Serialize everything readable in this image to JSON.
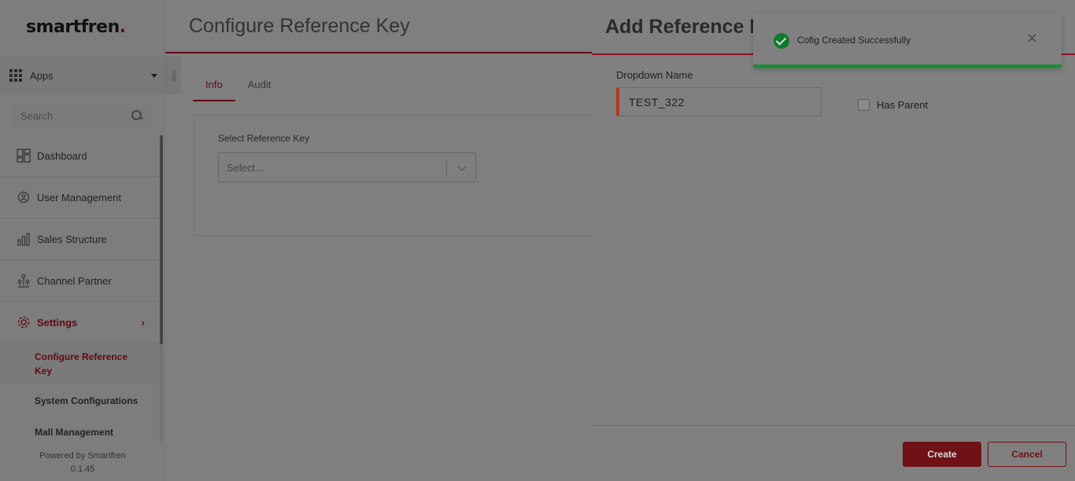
{
  "sidebar": {
    "brand": "smartfren",
    "brand_dot": ".",
    "apps_label": "Apps",
    "hide_label": "Hide",
    "search_placeholder": "Search",
    "items": [
      {
        "label": "Dashboard",
        "icon": "dashboard-icon"
      },
      {
        "label": "User Management",
        "icon": "user-gear-icon"
      },
      {
        "label": "Sales Structure",
        "icon": "bar-chart-icon"
      },
      {
        "label": "Channel Partner",
        "icon": "hierarchy-icon"
      },
      {
        "label": "Settings",
        "icon": "gear-icon",
        "chevron": "›"
      }
    ],
    "subitems": [
      {
        "label": "Configure Reference Key"
      },
      {
        "label": "System Configurations"
      },
      {
        "label": "Mall Management"
      }
    ],
    "powered_by": "Powered by Smartfren",
    "version": "0.1.45"
  },
  "main": {
    "title": "Configure Reference Key",
    "tabs": [
      {
        "label": "Info"
      },
      {
        "label": "Audit"
      }
    ],
    "select_label": "Select Reference Key",
    "select_placeholder": "Select..."
  },
  "panel": {
    "title": "Add Reference Key",
    "dropdown_name_label": "Dropdown Name",
    "dropdown_name_value": "TEST_322",
    "has_parent_label": "Has Parent",
    "create_label": "Create",
    "cancel_label": "Cancel"
  },
  "toast": {
    "message": "Cofig Created Successfully",
    "close_glyph": "✕"
  },
  "colors": {
    "accent": "#c8102e",
    "success": "#1f8a3a"
  }
}
